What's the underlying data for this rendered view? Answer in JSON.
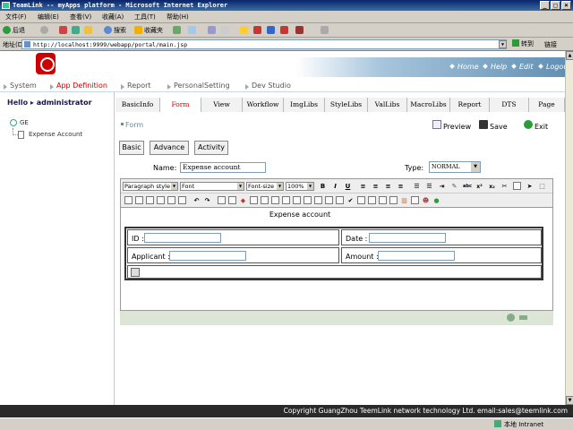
{
  "window": {
    "title": "TeamLink -- myApps platform - Microsoft Internet Explorer",
    "controls": [
      "_",
      "□",
      "×"
    ]
  },
  "menu": [
    "文件(F)",
    "编辑(E)",
    "查看(V)",
    "收藏(A)",
    "工具(T)",
    "帮助(H)"
  ],
  "toolbar": {
    "back_label": "后退",
    "search_label": "搜索",
    "favorites_label": "收藏夹"
  },
  "address": {
    "label": "地址(D)",
    "url": "http://localhost:9999/webapp/portal/main.jsp",
    "go_label": "转到",
    "links_label": "链接"
  },
  "header": {
    "links": [
      "Home",
      "Help",
      "Edit",
      "Logout"
    ]
  },
  "nav": {
    "items": [
      "System",
      "App Definition",
      "Report",
      "PersonalSetting",
      "Dev Studio"
    ],
    "active_index": 1
  },
  "sidebar": {
    "greeting": "Hello",
    "user": "administrator",
    "tree_root": "GE",
    "tree_child": "Expense Account"
  },
  "tabs": [
    "BasicInfo",
    "Form",
    "View",
    "Workflow",
    "ImgLibs",
    "StyleLibs",
    "ValLibs",
    "MacroLibs",
    "Report",
    "DTS",
    "Page"
  ],
  "active_tab": "Form",
  "crumb": "Form",
  "actions": {
    "preview": "Preview",
    "save": "Save",
    "exit": "Exit"
  },
  "subtabs": [
    "Basic",
    "Advance",
    "Activity"
  ],
  "form": {
    "name_label": "Name:",
    "name_value": "Expense account",
    "type_label": "Type:",
    "type_value": "NORMAL"
  },
  "editor": {
    "paragraph_style": "Paragraph style",
    "font": "Font",
    "font_size": "Font-size",
    "zoom": "100%",
    "bold": "B",
    "italic": "I",
    "underline": "U",
    "form_title": "Expense account",
    "fields": {
      "id": "ID :",
      "date": "Date :",
      "applicant": "Applicant :",
      "amount": "Amount :"
    }
  },
  "footer": {
    "copyright": "Copyright GuangZhou TeemLink network technology Ltd. email:sales@teemlink.com"
  },
  "status": {
    "zone": "本地 Intranet"
  }
}
